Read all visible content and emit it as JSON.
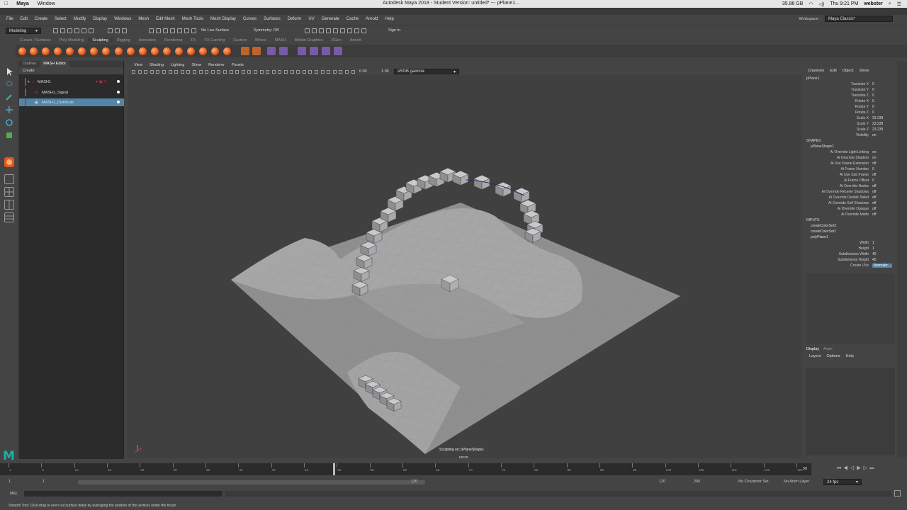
{
  "macbar": {
    "apple": "",
    "app": "Maya",
    "window_menu": "Window",
    "title": "Autodesk Maya 2018 - Student Version: untitled*  ---  pPlane1...",
    "storage": "35.86 GB",
    "clock": "Thu 9:21 PM",
    "user": "webster"
  },
  "menus": [
    "File",
    "Edit",
    "Create",
    "Select",
    "Modify",
    "Display",
    "Windows",
    "Mesh",
    "Edit Mesh",
    "Mesh Tools",
    "Mesh Display",
    "Curves",
    "Surfaces",
    "Deform",
    "UV",
    "Generate",
    "Cache",
    "Arnold",
    "Help"
  ],
  "workspace": {
    "label": "Workspace :",
    "value": "Maya Classic*"
  },
  "statusline": {
    "mode": "Modeling",
    "live_surface": "No Live Surface",
    "symmetry": "Symmetry: Off",
    "sign_in": "Sign In"
  },
  "shelf_tabs": [
    "Curves / Surfaces",
    "Poly Modeling",
    "Sculpting",
    "Rigging",
    "Animation",
    "Rendering",
    "FX",
    "FX Caching",
    "Custom",
    "Bifrost",
    "MASH",
    "Motion Graphics",
    "XGen",
    "Arnold"
  ],
  "shelf_active": "Sculpting",
  "outliner": {
    "tabs": [
      "Outliner",
      "MASH Editor"
    ],
    "create": "Create",
    "rows": [
      {
        "label": "MASH1"
      },
      {
        "label": "MASH1_Signal"
      },
      {
        "label": "MASH1_Distribute"
      }
    ]
  },
  "viewport": {
    "menu": [
      "View",
      "Shading",
      "Lighting",
      "Show",
      "Renderer",
      "Panels"
    ],
    "exposure": "0.00",
    "gamma": "1.00",
    "colorspace": "sRGB gamma",
    "status": "Sculpting on: pPlaneShape1",
    "camera": "persp"
  },
  "channelbox": {
    "menu": [
      "Channels",
      "Edit",
      "Object",
      "Show"
    ],
    "object": "pPlane1",
    "attrs": [
      {
        "k": "Translate X",
        "v": "0"
      },
      {
        "k": "Translate Y",
        "v": "0"
      },
      {
        "k": "Translate Z",
        "v": "0"
      },
      {
        "k": "Rotate X",
        "v": "0"
      },
      {
        "k": "Rotate Y",
        "v": "0"
      },
      {
        "k": "Rotate Z",
        "v": "0"
      },
      {
        "k": "Scale X",
        "v": "23.239"
      },
      {
        "k": "Scale Y",
        "v": "23.239"
      },
      {
        "k": "Scale Z",
        "v": "23.239"
      },
      {
        "k": "Visibility",
        "v": "on"
      }
    ],
    "shapes_label": "SHAPES",
    "shape": "pPlaneShape1",
    "shape_attrs": [
      {
        "k": "Ai Override Light Linking",
        "v": "on"
      },
      {
        "k": "Ai Override Shaders",
        "v": "on"
      },
      {
        "k": "Ai Use Frame Extension",
        "v": "off"
      },
      {
        "k": "Ai Frame Number",
        "v": "0"
      },
      {
        "k": "Ai Use Sub Frame",
        "v": "off"
      },
      {
        "k": "Ai Frame Offset",
        "v": "0"
      },
      {
        "k": "Ai Override Nodes",
        "v": "off"
      },
      {
        "k": "Ai Override Receive Shadows",
        "v": "off"
      },
      {
        "k": "Ai Override Double Sided",
        "v": "off"
      },
      {
        "k": "Ai Override Self Shadows",
        "v": "off"
      },
      {
        "k": "Ai Override Opaque",
        "v": "off"
      },
      {
        "k": "Ai Override Matte",
        "v": "off"
      }
    ],
    "inputs_label": "INPUTS",
    "inputs": [
      "createColorSet2",
      "createColorSet1",
      "polyPlane1"
    ],
    "poly_attrs": [
      {
        "k": "Width",
        "v": "1"
      },
      {
        "k": "Height",
        "v": "1"
      },
      {
        "k": "Subdivisions Width",
        "v": "40"
      },
      {
        "k": "Subdivisions Height",
        "v": "40"
      },
      {
        "k": "Create UVs",
        "v": "Normaliz..."
      }
    ]
  },
  "layereditor": {
    "tabs": [
      "Display",
      "Anim"
    ],
    "menu": [
      "Layers",
      "Options",
      "Help"
    ]
  },
  "timeslider": {
    "ticks": [
      "1",
      "5",
      "10",
      "15",
      "20",
      "25",
      "30",
      "35",
      "40",
      "45",
      "50",
      "55",
      "60",
      "65",
      "70",
      "75",
      "80",
      "85",
      "90",
      "95",
      "100",
      "105",
      "110",
      "115",
      "120"
    ],
    "current": "50"
  },
  "range": {
    "start": "1",
    "start2": "1",
    "end_inner": "120",
    "end_outer": "120",
    "max": "200",
    "character": "No Character Set",
    "anim_layer": "No Anim Layer",
    "fps": "24 fps"
  },
  "cmdline": {
    "label": "MEL"
  },
  "help": "Smooth Tool: Click-drag to even out surface detail by averaging the position of the vertices under the brush.",
  "colors": {
    "accent": "#5285a6",
    "shelf_orange": "#e2581e",
    "outliner_red": "#d8274a",
    "viewport_bg": "#404040"
  }
}
